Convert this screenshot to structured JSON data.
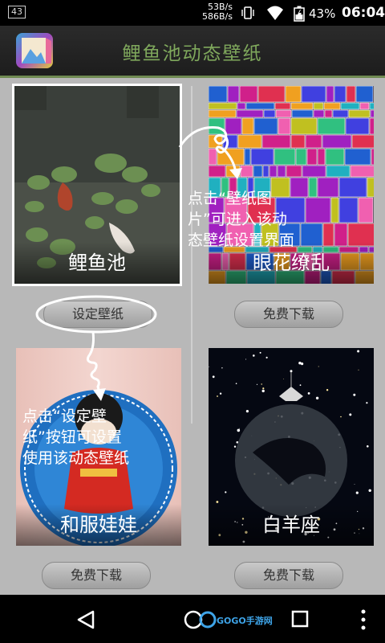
{
  "status_bar": {
    "notification_count": "43",
    "net_up": "53B/s",
    "net_down": "586B/s",
    "battery_pct": "43%",
    "time": "06:04"
  },
  "app": {
    "title": "鲤鱼池动态壁纸",
    "icon": "app-icon"
  },
  "wallpapers": [
    {
      "name": "鲤鱼池",
      "button": "设定壁纸",
      "selected": true
    },
    {
      "name": "眼花缭乱",
      "button": "免费下载",
      "selected": false
    },
    {
      "name": "和服娃娃",
      "button": "免费下载",
      "selected": false
    },
    {
      "name": "白羊座",
      "button": "免费下载",
      "selected": false
    }
  ],
  "hints": {
    "tap_image": [
      "点击“壁纸图",
      "片”可进入该动",
      "态壁纸设置界面"
    ],
    "tap_button": [
      "点击“设定壁",
      "纸”按钮可设置",
      "使用该动态壁纸"
    ]
  },
  "nav": {
    "back": "back-icon",
    "home": "home-icon",
    "recents": "recents-icon",
    "menu": "overflow-menu-icon"
  },
  "watermark": {
    "text": "GOGO手游网"
  },
  "colors": {
    "title_green": "#7fa85c",
    "accent_line": "#6f8a52"
  }
}
